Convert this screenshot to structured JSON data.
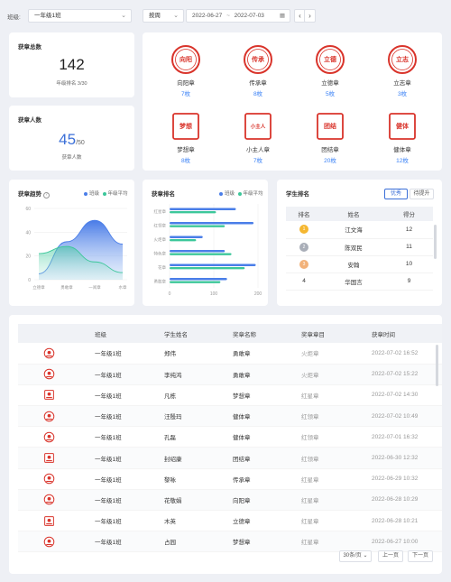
{
  "filter": {
    "class_label": "班级:",
    "class_value": "一年级1班",
    "period_value": "按周",
    "date_start": "2022-06-27",
    "date_sep": "~",
    "date_end": "2022-07-03"
  },
  "stats": {
    "total_badges": {
      "title": "获章总数",
      "value": "142",
      "rank_text": "年级排名 3/30"
    },
    "badge_people": {
      "title": "获章人数",
      "value": "45",
      "total": "/50",
      "caption": "获章人数"
    }
  },
  "badges": [
    {
      "name": "向阳章",
      "count": "7枚",
      "color": "#d9342b",
      "icon": "sun-badge-icon",
      "art": "向阳"
    },
    {
      "name": "传承章",
      "count": "8枚",
      "color": "#d9342b",
      "icon": "heritage-badge-icon",
      "art": "传承"
    },
    {
      "name": "立德章",
      "count": "5枚",
      "color": "#d9342b",
      "icon": "virtue-badge-icon",
      "art": "立德"
    },
    {
      "name": "立志章",
      "count": "3枚",
      "color": "#d9342b",
      "icon": "ambition-badge-icon",
      "art": "立志"
    },
    {
      "name": "梦想章",
      "count": "8枚",
      "color": "#d9342b",
      "icon": "dream-badge-icon",
      "art": "梦想"
    },
    {
      "name": "小主人章",
      "count": "7枚",
      "color": "#d9342b",
      "icon": "little-master-badge-icon",
      "art": "小主人"
    },
    {
      "name": "团结章",
      "count": "20枚",
      "color": "#d9342b",
      "icon": "unity-badge-icon",
      "art": "团结"
    },
    {
      "name": "健体章",
      "count": "12枚",
      "color": "#d9342b",
      "icon": "fitness-badge-icon",
      "art": "健体"
    }
  ],
  "trend": {
    "title": "获章趋势",
    "legend": [
      "班级",
      "年级平均"
    ],
    "colors": {
      "class": "#4a7ee8",
      "grade": "#3cc79a"
    }
  },
  "ranking": {
    "title": "获章排名",
    "legend": [
      "班级",
      "年级平均"
    ]
  },
  "student_rank": {
    "title": "学生排名",
    "tabs": [
      "优秀",
      "待提升"
    ],
    "headers": [
      "排名",
      "姓名",
      "得分"
    ],
    "rows": [
      {
        "rank": "1",
        "name": "江文海",
        "score": "12",
        "medal": "#f5b731"
      },
      {
        "rank": "2",
        "name": "陈双民",
        "score": "11",
        "medal": "#a9aeb8"
      },
      {
        "rank": "3",
        "name": "安翰",
        "score": "10",
        "medal": "#f2b27a"
      },
      {
        "rank": "4",
        "name": "华国言",
        "score": "9",
        "medal": ""
      }
    ]
  },
  "records": {
    "headers": [
      "班级",
      "学生姓名",
      "奖章名称",
      "奖章章目",
      "获章时间"
    ],
    "rows": [
      {
        "class": "一年级1班",
        "student": "郑伟",
        "badge": "勇敢章",
        "category": "火炬章",
        "time": "2022-07-02 16:52"
      },
      {
        "class": "一年级1班",
        "student": "李纯鸿",
        "badge": "勇敢章",
        "category": "火炬章",
        "time": "2022-07-02 15:22"
      },
      {
        "class": "一年级1班",
        "student": "凡栋",
        "badge": "梦想章",
        "category": "红星章",
        "time": "2022-07-02 14:30"
      },
      {
        "class": "一年级1班",
        "student": "汪殷玛",
        "badge": "健体章",
        "category": "红领章",
        "time": "2022-07-02 10:49"
      },
      {
        "class": "一年级1班",
        "student": "孔磊",
        "badge": "健体章",
        "category": "红领章",
        "time": "2022-07-01 16:32"
      },
      {
        "class": "一年级1班",
        "student": "封绍康",
        "badge": "团结章",
        "category": "红领章",
        "time": "2022-06-30 12:32"
      },
      {
        "class": "一年级1班",
        "student": "黎咏",
        "badge": "传承章",
        "category": "红星章",
        "time": "2022-06-29 10:32"
      },
      {
        "class": "一年级1班",
        "student": "花敬娟",
        "badge": "向阳章",
        "category": "红星章",
        "time": "2022-06-28 10:29"
      },
      {
        "class": "一年级1班",
        "student": "木英",
        "badge": "立德章",
        "category": "红星章",
        "time": "2022-06-28 10:21"
      },
      {
        "class": "一年级1班",
        "student": "占园",
        "badge": "梦想章",
        "category": "红星章",
        "time": "2022-06-27 10:00"
      }
    ]
  },
  "pagination": {
    "page_size": "30条/页",
    "prev": "上一页",
    "next": "下一页"
  },
  "chart_data": [
    {
      "type": "area",
      "title": "获章趋势",
      "categories": [
        "立德章",
        "勇敢章",
        "一阅章",
        "水章"
      ],
      "ylim": [
        0,
        60
      ],
      "yticks": [
        0,
        20,
        40,
        60
      ],
      "series": [
        {
          "name": "班级",
          "values": [
            5,
            32,
            50,
            30
          ]
        },
        {
          "name": "年级平均",
          "values": [
            22,
            28,
            15,
            6
          ]
        }
      ]
    },
    {
      "type": "bar",
      "title": "获章排名",
      "categories": [
        "红星章",
        "红领章",
        "火炬章",
        "特色章",
        "花章",
        "勇敢章"
      ],
      "xlim": [
        0,
        200
      ],
      "xticks": [
        0,
        100,
        200
      ],
      "series": [
        {
          "name": "班级",
          "values": [
            150,
            190,
            75,
            125,
            195,
            130
          ]
        },
        {
          "name": "年级平均",
          "values": [
            105,
            125,
            60,
            140,
            170,
            115
          ]
        }
      ]
    }
  ]
}
